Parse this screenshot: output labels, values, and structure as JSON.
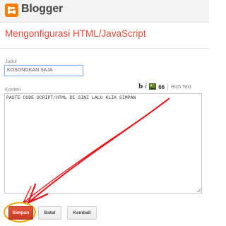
{
  "header": {
    "brand": "Blogger",
    "logo_icon": "blogger-logo-icon",
    "logo_color": "#f57d00"
  },
  "page": {
    "title": "Mengonfigurasi HTML/JavaScript",
    "title_color": "#dd4b39"
  },
  "form": {
    "title_label": "Judul",
    "title_value": "KOSONGKAN SAJA",
    "content_label": "Konten",
    "content_value": "PASTE CODE SCRIPT/HTML DI SINI LALU KLIK SIMPAN"
  },
  "toolbar": {
    "bold_label": "b",
    "italic_label": "i",
    "image_icon": "image-icon",
    "quote_label": "66",
    "rich_text_label": "Rich Text"
  },
  "buttons": {
    "save_label": "Simpan",
    "cancel_label": "Batal",
    "back_label": "Kembali",
    "save_color": "#d9472f"
  },
  "annotation": {
    "arrow_color": "#e8141c",
    "highlight_color": "#f0a800"
  }
}
